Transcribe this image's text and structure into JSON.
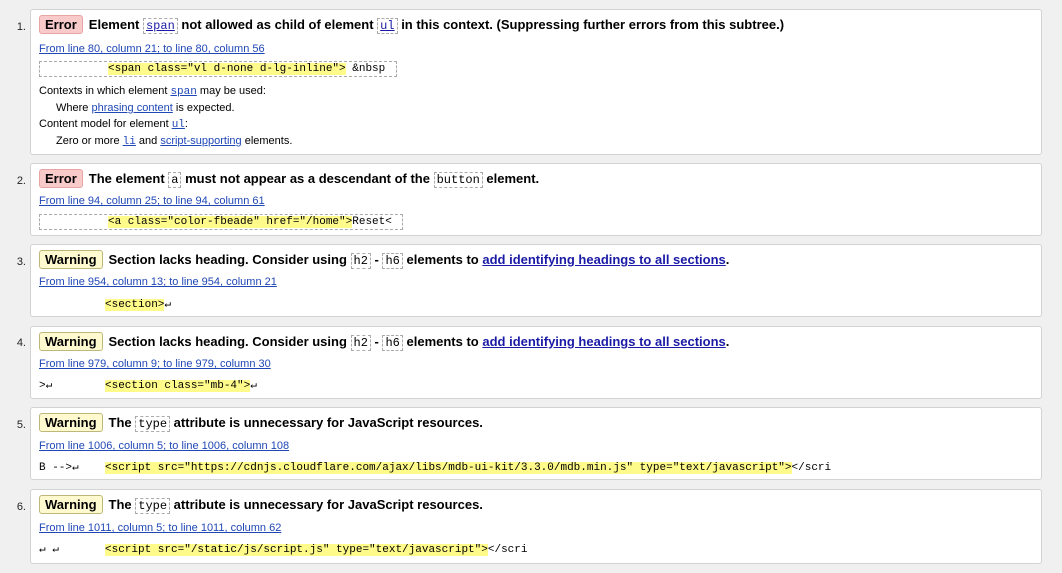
{
  "messages": [
    {
      "n": "1.",
      "type": "Error",
      "pre": "Element ",
      "c1": "span",
      "mid": " not allowed as child of element ",
      "c2": "ul",
      "post": " in this context. (Suppressing further errors from this subtree.)",
      "loc": "From line 80, column 21; to line 80, column 56",
      "src_hl": "<span class=\"vl d-none d-lg-inline\">",
      "src_post": " &nbsp"
    },
    {
      "n": "2.",
      "type": "Error",
      "pre": "The element ",
      "c1": "a",
      "mid": " must not appear as a descendant of the ",
      "c2": "button",
      "post": " element.",
      "loc": "From line 94, column 25; to line 94, column 61",
      "src_hl": "<a class=\"color-fbeade\" href=\"/home\">",
      "src_post": "Reset<"
    },
    {
      "n": "3.",
      "type": "Warning",
      "pre": "Section lacks heading. Consider using ",
      "c1": "h2",
      "mid": " - ",
      "c2": "h6",
      "post": " elements to ",
      "link": "add identifying headings to all sections",
      "post2": ".",
      "loc": "From line 954, column 13; to line 954, column 21",
      "src_pre": "",
      "src_hl": "<section>",
      "src_post": "↵"
    },
    {
      "n": "4.",
      "type": "Warning",
      "pre": "Section lacks heading. Consider using ",
      "c1": "h2",
      "mid": " - ",
      "c2": "h6",
      "post": " elements to ",
      "link": "add identifying headings to all sections",
      "post2": ".",
      "loc": "From line 979, column 9; to line 979, column 30",
      "src_pre": ">↵",
      "src_hl": "<section class=\"mb-4\">",
      "src_post": "↵"
    },
    {
      "n": "5.",
      "type": "Warning",
      "pre": "The ",
      "c1": "type",
      "post": " attribute is unnecessary for JavaScript resources.",
      "loc": "From line 1006, column 5; to line 1006, column 108",
      "src_pre": "B -->↵",
      "src_hl": "<script src=\"https://cdnjs.cloudflare.com/ajax/libs/mdb-ui-kit/3.3.0/mdb.min.js\" type=\"text/javascript\">",
      "src_post": "</scri"
    },
    {
      "n": "6.",
      "type": "Warning",
      "pre": "The ",
      "c1": "type",
      "post": " attribute is unnecessary for JavaScript resources.",
      "loc": "From line 1011, column 5; to line 1011, column 62",
      "src_pre": "↵    ↵",
      "src_hl": "<script src=\"/static/js/script.js\" type=\"text/javascript\">",
      "src_post": "</scri"
    }
  ],
  "context1": {
    "l1_pre": "Contexts in which element ",
    "l1_code": "span",
    "l1_post": " may be used:",
    "l2_pre": "Where ",
    "l2_link": "phrasing content",
    "l2_post": " is expected.",
    "l3_pre": "Content model for element ",
    "l3_code": "ul",
    "l3_post": ":",
    "l4_pre": "Zero or more ",
    "l4_code": "li",
    "l4_mid": " and ",
    "l4_link": "script-supporting",
    "l4_post": " elements."
  }
}
